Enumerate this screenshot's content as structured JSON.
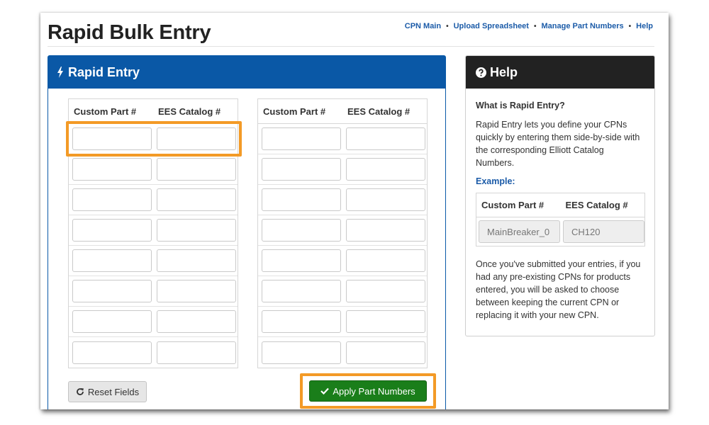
{
  "page": {
    "title": "Rapid Bulk Entry"
  },
  "topnav": {
    "links": [
      "CPN Main",
      "Upload Spreadsheet",
      "Manage Part Numbers",
      "Help"
    ],
    "separator": "•"
  },
  "rapid_entry": {
    "header": "Rapid Entry",
    "columns": [
      "Custom Part #",
      "EES Catalog #"
    ],
    "rows_per_table": 8,
    "reset_label": "Reset Fields",
    "apply_label": "Apply Part Numbers"
  },
  "help": {
    "header": "Help",
    "question": "What is Rapid Entry?",
    "intro": "Rapid Entry lets you define your CPNs quickly by entering them side-by-side with the corresponding Elliott Catalog Numbers.",
    "example_label": "Example:",
    "example_columns": [
      "Custom Part #",
      "EES Catalog #"
    ],
    "example_values": [
      "MainBreaker_0",
      "CH120"
    ],
    "outro": "Once you've submitted your entries, if you had any pre-existing CPNs for products entered, you will be asked to choose between keeping the current CPN or replacing it with your new CPN."
  },
  "colors": {
    "rapid_header": "#0a58a6",
    "help_header": "#222222",
    "apply_button": "#1a7e1a",
    "highlight": "#f39a26",
    "link": "#1b5ba8"
  },
  "icons": {
    "rapid_entry": "bolt-icon",
    "help": "question-circle-icon",
    "reset": "refresh-icon",
    "apply": "checkmark-icon"
  }
}
